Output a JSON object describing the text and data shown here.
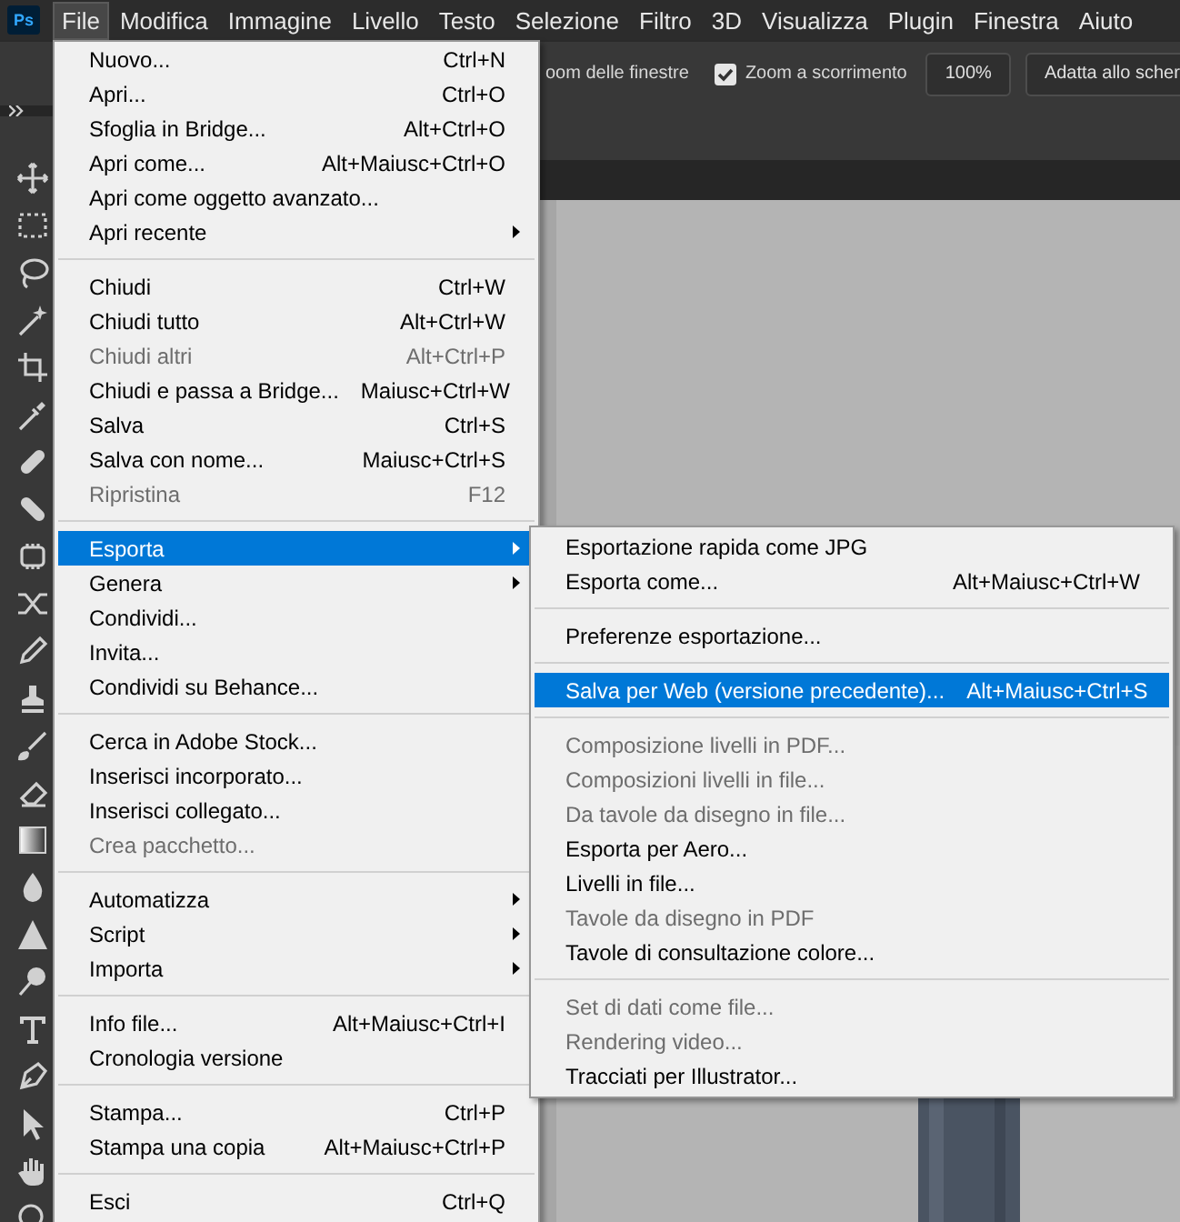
{
  "menubar": {
    "logo": "Ps",
    "items": [
      {
        "label": "File",
        "selected": true
      },
      {
        "label": "Modifica",
        "selected": false
      },
      {
        "label": "Immagine",
        "selected": false
      },
      {
        "label": "Livello",
        "selected": false
      },
      {
        "label": "Testo",
        "selected": false
      },
      {
        "label": "Selezione",
        "selected": false
      },
      {
        "label": "Filtro",
        "selected": false
      },
      {
        "label": "3D",
        "selected": false
      },
      {
        "label": "Visualizza",
        "selected": false
      },
      {
        "label": "Plugin",
        "selected": false
      },
      {
        "label": "Finestra",
        "selected": false
      },
      {
        "label": "Aiuto",
        "selected": false
      }
    ]
  },
  "options_bar": {
    "partial_label": "oom delle finestre",
    "zoom_checkbox": {
      "label": "Zoom a scorrimento",
      "checked": true
    },
    "zoom_button": "100%",
    "fit_button": "Adatta allo scher"
  },
  "file_menu": {
    "items": [
      {
        "kind": "item",
        "label": "Nuovo...",
        "shortcut": "Ctrl+N",
        "disabled": false,
        "selected": false,
        "submenu": false
      },
      {
        "kind": "item",
        "label": "Apri...",
        "shortcut": "Ctrl+O",
        "disabled": false,
        "selected": false,
        "submenu": false
      },
      {
        "kind": "item",
        "label": "Sfoglia in Bridge...",
        "shortcut": "Alt+Ctrl+O",
        "disabled": false,
        "selected": false,
        "submenu": false
      },
      {
        "kind": "item",
        "label": "Apri come...",
        "shortcut": "Alt+Maiusc+Ctrl+O",
        "disabled": false,
        "selected": false,
        "submenu": false
      },
      {
        "kind": "item",
        "label": "Apri come oggetto avanzato...",
        "disabled": false,
        "selected": false,
        "submenu": false
      },
      {
        "kind": "item",
        "label": "Apri recente",
        "disabled": false,
        "selected": false,
        "submenu": true
      },
      {
        "kind": "separator"
      },
      {
        "kind": "item",
        "label": "Chiudi",
        "shortcut": "Ctrl+W",
        "disabled": false,
        "selected": false,
        "submenu": false
      },
      {
        "kind": "item",
        "label": "Chiudi tutto",
        "shortcut": "Alt+Ctrl+W",
        "disabled": false,
        "selected": false,
        "submenu": false
      },
      {
        "kind": "item",
        "label": "Chiudi altri",
        "shortcut": "Alt+Ctrl+P",
        "disabled": true,
        "selected": false,
        "submenu": false
      },
      {
        "kind": "item",
        "label": "Chiudi e passa a Bridge...",
        "shortcut": "Maiusc+Ctrl+W",
        "disabled": false,
        "selected": false,
        "submenu": false
      },
      {
        "kind": "item",
        "label": "Salva",
        "shortcut": "Ctrl+S",
        "disabled": false,
        "selected": false,
        "submenu": false
      },
      {
        "kind": "item",
        "label": "Salva con nome...",
        "shortcut": "Maiusc+Ctrl+S",
        "disabled": false,
        "selected": false,
        "submenu": false
      },
      {
        "kind": "item",
        "label": "Ripristina",
        "shortcut": "F12",
        "disabled": true,
        "selected": false,
        "submenu": false
      },
      {
        "kind": "separator"
      },
      {
        "kind": "item",
        "label": "Esporta",
        "disabled": false,
        "selected": true,
        "submenu": true
      },
      {
        "kind": "item",
        "label": "Genera",
        "disabled": false,
        "selected": false,
        "submenu": true
      },
      {
        "kind": "item",
        "label": "Condividi...",
        "disabled": false,
        "selected": false,
        "submenu": false
      },
      {
        "kind": "item",
        "label": "Invita...",
        "disabled": false,
        "selected": false,
        "submenu": false
      },
      {
        "kind": "item",
        "label": "Condividi su Behance...",
        "disabled": false,
        "selected": false,
        "submenu": false
      },
      {
        "kind": "separator"
      },
      {
        "kind": "item",
        "label": "Cerca in Adobe Stock...",
        "disabled": false,
        "selected": false,
        "submenu": false
      },
      {
        "kind": "item",
        "label": "Inserisci incorporato...",
        "disabled": false,
        "selected": false,
        "submenu": false
      },
      {
        "kind": "item",
        "label": "Inserisci collegato...",
        "disabled": false,
        "selected": false,
        "submenu": false
      },
      {
        "kind": "item",
        "label": "Crea pacchetto...",
        "disabled": true,
        "selected": false,
        "submenu": false
      },
      {
        "kind": "separator"
      },
      {
        "kind": "item",
        "label": "Automatizza",
        "disabled": false,
        "selected": false,
        "submenu": true
      },
      {
        "kind": "item",
        "label": "Script",
        "disabled": false,
        "selected": false,
        "submenu": true
      },
      {
        "kind": "item",
        "label": "Importa",
        "disabled": false,
        "selected": false,
        "submenu": true
      },
      {
        "kind": "separator"
      },
      {
        "kind": "item",
        "label": "Info file...",
        "shortcut": "Alt+Maiusc+Ctrl+I",
        "disabled": false,
        "selected": false,
        "submenu": false
      },
      {
        "kind": "item",
        "label": "Cronologia versione",
        "disabled": false,
        "selected": false,
        "submenu": false
      },
      {
        "kind": "separator"
      },
      {
        "kind": "item",
        "label": "Stampa...",
        "shortcut": "Ctrl+P",
        "disabled": false,
        "selected": false,
        "submenu": false
      },
      {
        "kind": "item",
        "label": "Stampa una copia",
        "shortcut": "Alt+Maiusc+Ctrl+P",
        "disabled": false,
        "selected": false,
        "submenu": false
      },
      {
        "kind": "separator"
      },
      {
        "kind": "item",
        "label": "Esci",
        "shortcut": "Ctrl+Q",
        "disabled": false,
        "selected": false,
        "submenu": false
      }
    ]
  },
  "export_submenu": {
    "items": [
      {
        "kind": "item",
        "label": "Esportazione rapida come JPG",
        "disabled": false,
        "selected": false,
        "submenu": false
      },
      {
        "kind": "item",
        "label": "Esporta come...",
        "shortcut": "Alt+Maiusc+Ctrl+W",
        "disabled": false,
        "selected": false,
        "submenu": false
      },
      {
        "kind": "separator"
      },
      {
        "kind": "item",
        "label": "Preferenze esportazione...",
        "disabled": false,
        "selected": false,
        "submenu": false
      },
      {
        "kind": "separator"
      },
      {
        "kind": "item",
        "label": "Salva per Web (versione precedente)...",
        "shortcut": "Alt+Maiusc+Ctrl+S",
        "disabled": false,
        "selected": true,
        "submenu": false
      },
      {
        "kind": "separator"
      },
      {
        "kind": "item",
        "label": "Composizione livelli in PDF...",
        "disabled": true,
        "selected": false,
        "submenu": false
      },
      {
        "kind": "item",
        "label": "Composizioni livelli in file...",
        "disabled": true,
        "selected": false,
        "submenu": false
      },
      {
        "kind": "item",
        "label": "Da tavole da disegno in file...",
        "disabled": true,
        "selected": false,
        "submenu": false
      },
      {
        "kind": "item",
        "label": "Esporta per Aero...",
        "disabled": false,
        "selected": false,
        "submenu": false
      },
      {
        "kind": "item",
        "label": "Livelli in file...",
        "disabled": false,
        "selected": false,
        "submenu": false
      },
      {
        "kind": "item",
        "label": "Tavole da disegno in PDF",
        "disabled": true,
        "selected": false,
        "submenu": false
      },
      {
        "kind": "item",
        "label": "Tavole di consultazione colore...",
        "disabled": false,
        "selected": false,
        "submenu": false
      },
      {
        "kind": "separator"
      },
      {
        "kind": "item",
        "label": "Set di dati come file...",
        "disabled": true,
        "selected": false,
        "submenu": false
      },
      {
        "kind": "item",
        "label": "Rendering video...",
        "disabled": true,
        "selected": false,
        "submenu": false
      },
      {
        "kind": "item",
        "label": "Tracciati per Illustrator...",
        "disabled": false,
        "selected": false,
        "submenu": false
      }
    ]
  }
}
